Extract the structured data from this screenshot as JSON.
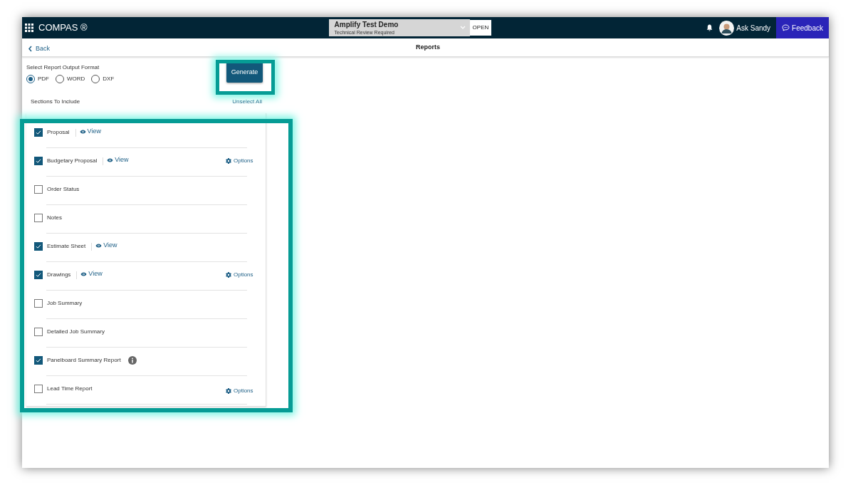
{
  "header": {
    "app_title": "COMPAS ®",
    "project": {
      "name": "Amplify Test Demo",
      "status": "Technical Review Required",
      "badge": "OPEN"
    },
    "assistant": "Ask Sandy",
    "feedback": "Feedback"
  },
  "subheader": {
    "back": "Back",
    "title": "Reports"
  },
  "format": {
    "label": "Select Report Output Format",
    "options": [
      {
        "label": "PDF",
        "selected": true
      },
      {
        "label": "WORD",
        "selected": false
      },
      {
        "label": "DXF",
        "selected": false
      }
    ]
  },
  "generate": "Generate",
  "sections_label": "Sections To Include",
  "unselect_all": "Unselect All",
  "sections": [
    {
      "label": "Proposal",
      "checked": true,
      "view": "View"
    },
    {
      "label": "Budgetary Proposal",
      "checked": true,
      "view": "View",
      "options": "Options"
    },
    {
      "label": "Order Status",
      "checked": false
    },
    {
      "label": "Notes",
      "checked": false
    },
    {
      "label": "Estimate Sheet",
      "checked": true,
      "view": "View"
    },
    {
      "label": "Drawings",
      "checked": true,
      "view": "View",
      "options": "Options"
    },
    {
      "label": "Job Summary",
      "checked": false
    },
    {
      "label": "Detailed Job Summary",
      "checked": false
    },
    {
      "label": "Panelboard Summary Report",
      "checked": true,
      "info": true
    },
    {
      "label": "Lead Time Report",
      "checked": false,
      "options": "Options"
    }
  ]
}
